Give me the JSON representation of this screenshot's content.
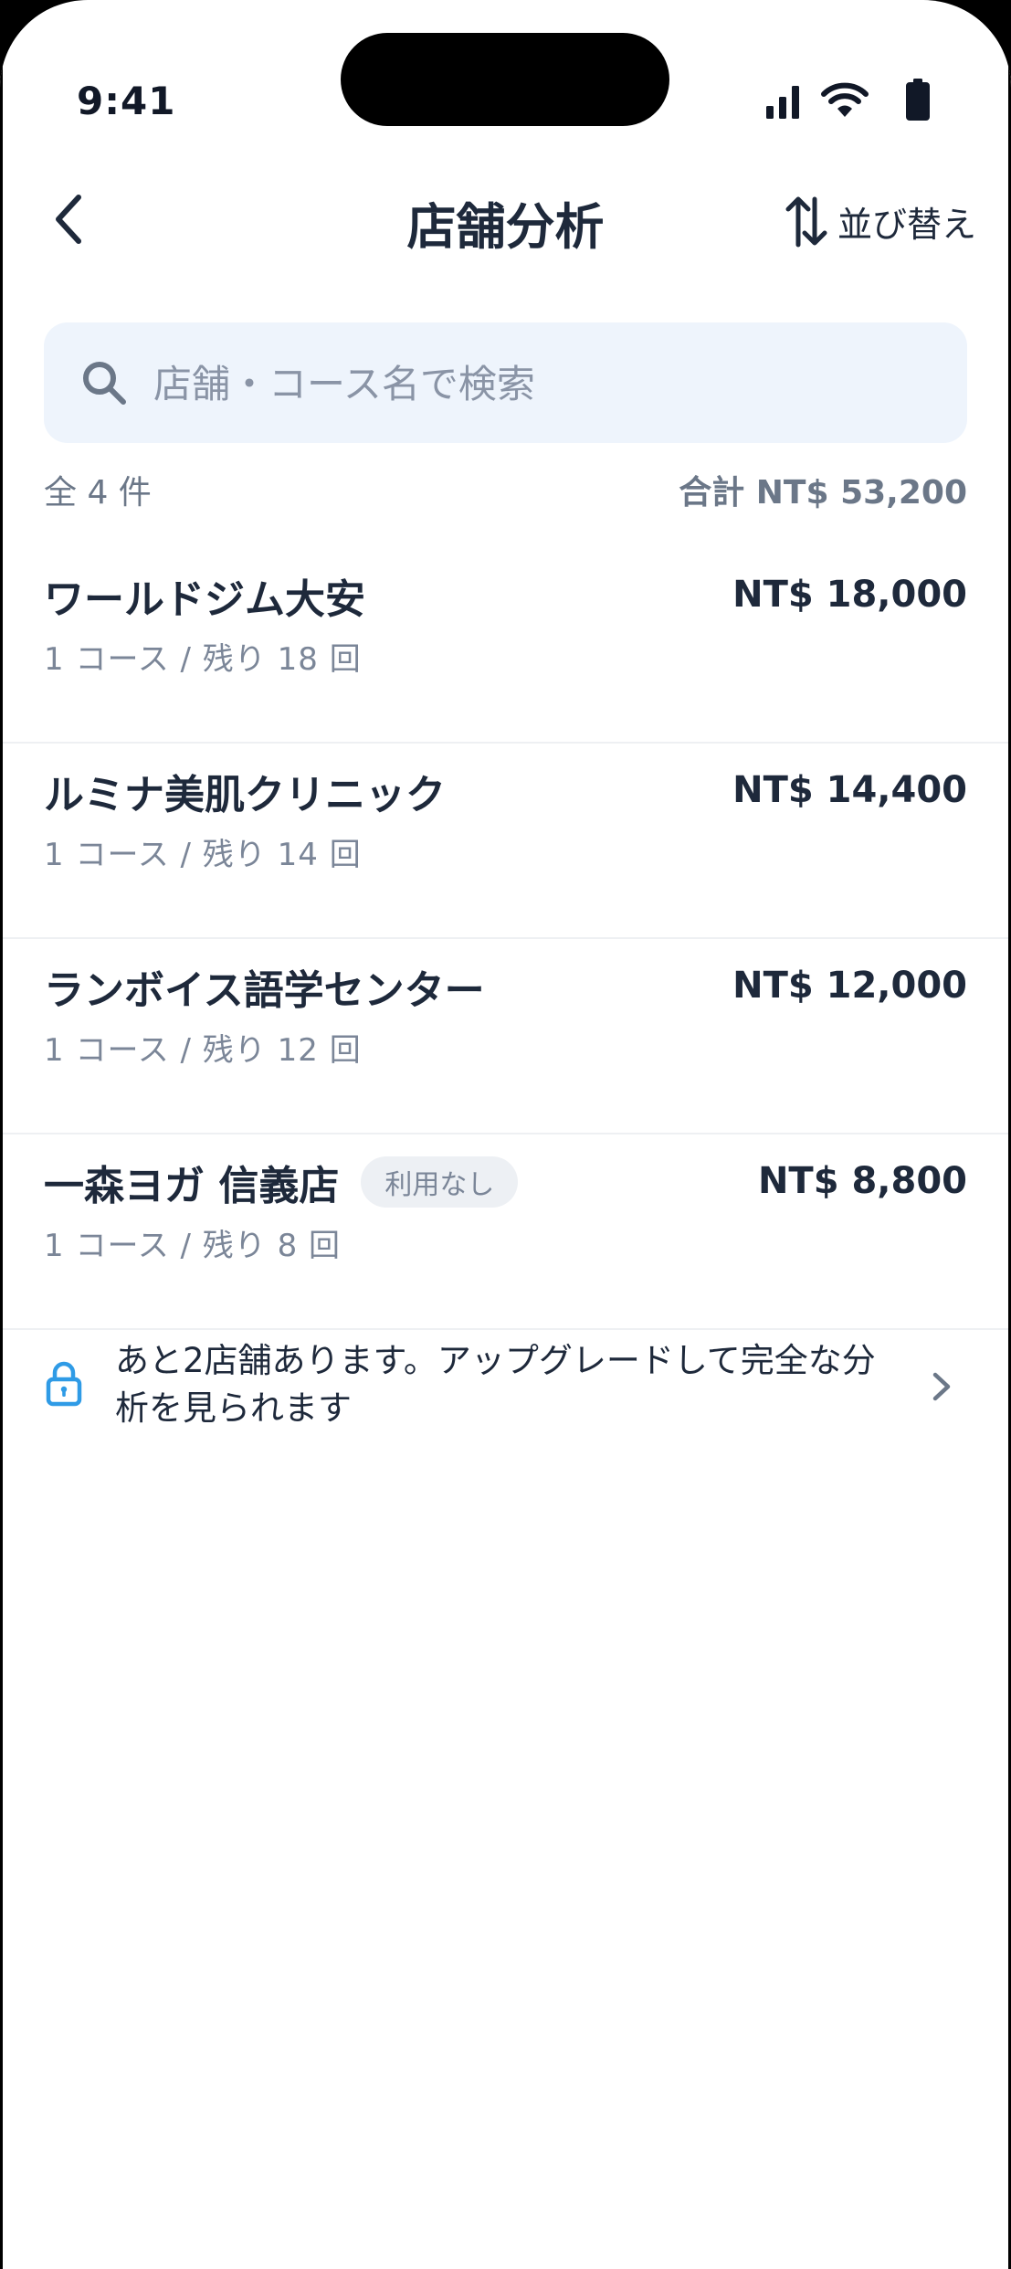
{
  "status_bar": {
    "time": "9:41"
  },
  "nav": {
    "title": "店舗分析",
    "sort_label": "並び替え"
  },
  "search": {
    "placeholder": "店舗・コース名で検索",
    "value": ""
  },
  "summary": {
    "count": "全 4 件",
    "total": "合計 NT$ 53,200"
  },
  "stores": [
    {
      "name": "ワールドジム大安",
      "sub": "1 コース / 残り 18 回",
      "amount": "NT$ 18,000",
      "badge": ""
    },
    {
      "name": "ルミナ美肌クリニック",
      "sub": "1 コース / 残り 14 回",
      "amount": "NT$ 14,400",
      "badge": ""
    },
    {
      "name": "ランボイス語学センター",
      "sub": "1 コース / 残り 12 回",
      "amount": "NT$ 12,000",
      "badge": ""
    },
    {
      "name": "一森ヨガ 信義店",
      "sub": "1 コース / 残り 8 回",
      "amount": "NT$ 8,800",
      "badge": "利用なし"
    }
  ],
  "upgrade": {
    "text": "あと2店舗あります。アップグレードして完全な分析を見られます"
  },
  "colors": {
    "text_primary": "#1e293b",
    "text_secondary": "#7b8698",
    "search_bg": "#eef4fc",
    "accent_lock": "#2f9be6"
  }
}
